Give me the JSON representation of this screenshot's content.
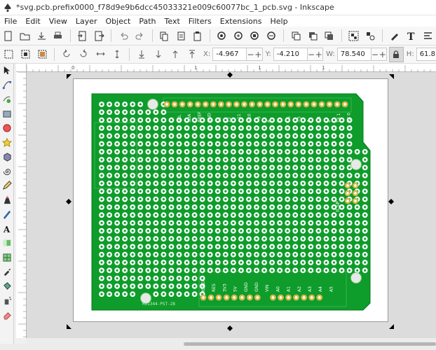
{
  "window": {
    "title": "*svg.pcb.prefix0000_f78d9e9b6dcc45033321e009c60077bc_1_pcb.svg - Inkscape"
  },
  "menu": [
    "File",
    "Edit",
    "View",
    "Layer",
    "Object",
    "Path",
    "Text",
    "Filters",
    "Extensions",
    "Help"
  ],
  "toolbar1": [
    "new-icon",
    "open-icon",
    "save-icon",
    "print-icon",
    "import-icon",
    "export-icon",
    "undo-icon",
    "redo-icon",
    "copy-icon",
    "cut-icon",
    "paste-icon",
    "zoom-selection-icon",
    "zoom-drawing-icon",
    "zoom-page-icon",
    "zoom-width-icon",
    "duplicate-icon",
    "clone-icon",
    "unlink-clone-icon",
    "group-icon",
    "ungroup-icon",
    "fill-stroke-icon",
    "text-font-icon",
    "align-icon"
  ],
  "toolbar2": {
    "buttons": [
      "select-all-icon",
      "select-all-layers-icon",
      "deselect-icon",
      "rotate-ccw-icon",
      "rotate-cw-icon",
      "flip-horizontal-icon",
      "flip-vertical-icon",
      "lower-bottom-icon",
      "lower-icon",
      "raise-icon",
      "raise-top-icon"
    ],
    "x_label": "X:",
    "x_value": "-4.967",
    "y_label": "Y:",
    "y_value": "-4.210",
    "w_label": "W:",
    "w_value": "78.540",
    "h_label": "H:",
    "h_value": "61.8"
  },
  "tools": [
    "selector-tool-icon",
    "node-tool-icon",
    "tweak-tool-icon",
    "rectangle-tool-icon",
    "ellipse-tool-icon",
    "star-tool-icon",
    "3d-box-tool-icon",
    "spiral-tool-icon",
    "pencil-tool-icon",
    "pen-tool-icon",
    "calligraphy-tool-icon",
    "text-tool-icon",
    "gradient-tool-icon",
    "mesh-tool-icon",
    "dropper-tool-icon",
    "paint-bucket-tool-icon",
    "spray-tool-icon",
    "eraser-tool-icon"
  ],
  "ruler": {
    "top_labels": [
      "0",
      "1",
      "1",
      "1"
    ]
  },
  "pcb": {
    "header_top_labels": [
      "SCL",
      "SDA",
      "AREF",
      "GND",
      "13",
      "12",
      "~11",
      "~10",
      "~9",
      "8",
      "7",
      "~6",
      "~5",
      "4",
      "~3",
      "2",
      "TX 1",
      "RX 0"
    ],
    "header_bottom_labels": [
      "IOREF",
      "RES",
      "3V3",
      "5V",
      "GND",
      "GND",
      "VIN",
      "A0",
      "A1",
      "A2",
      "A3",
      "A4",
      "A5"
    ],
    "icsp_label": "ICSP",
    "part_number": "RS1344-PST-28",
    "colors": {
      "board": "#0e9c2a",
      "pad": "#ffffff",
      "pad_hole": "#1aa23a",
      "gold": "#d6b84a"
    }
  }
}
